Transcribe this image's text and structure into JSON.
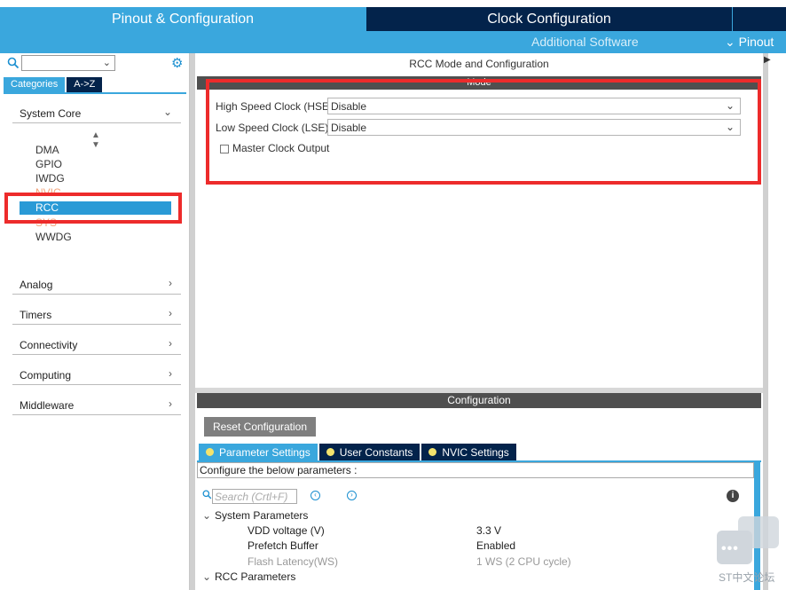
{
  "top_tabs": {
    "pinout": "Pinout & Configuration",
    "clock": "Clock Configuration"
  },
  "subnav": {
    "additional": "Additional Software",
    "pinout": "Pinout"
  },
  "left": {
    "tabs": [
      "Categories",
      "A->Z"
    ],
    "sections": {
      "system_core": "System Core",
      "analog": "Analog",
      "timers": "Timers",
      "connectivity": "Connectivity",
      "computing": "Computing",
      "middleware": "Middleware"
    },
    "system_core_items": [
      "DMA",
      "GPIO",
      "IWDG",
      "NVIC",
      "RCC",
      "SYS",
      "WWDG"
    ]
  },
  "mode": {
    "title": "RCC Mode and Configuration",
    "header": "Mode",
    "hse_label": "High Speed Clock (HSE)",
    "hse_value": "Disable",
    "lse_label": "Low Speed Clock (LSE)",
    "lse_value": "Disable",
    "mco_label": "Master Clock Output"
  },
  "config": {
    "header": "Configuration",
    "reset_label": "Reset Configuration",
    "tabs": [
      "Parameter Settings",
      "User Constants",
      "NVIC Settings"
    ],
    "desc": "Configure the below parameters :",
    "search_placeholder": "Search (Crtl+F)",
    "groups": {
      "system": "System Parameters",
      "rcc": "RCC Parameters"
    },
    "params": [
      {
        "name": "VDD voltage (V)",
        "value": "3.3 V"
      },
      {
        "name": "Prefetch Buffer",
        "value": "Enabled"
      },
      {
        "name": "Flash Latency(WS)",
        "value": "1 WS (2 CPU cycle)"
      }
    ]
  },
  "watermark": {
    "text": "ST中文论坛"
  },
  "colors": {
    "accent": "#3aa7dd",
    "dark": "#03234b",
    "highlight": "#ed2b2b"
  }
}
